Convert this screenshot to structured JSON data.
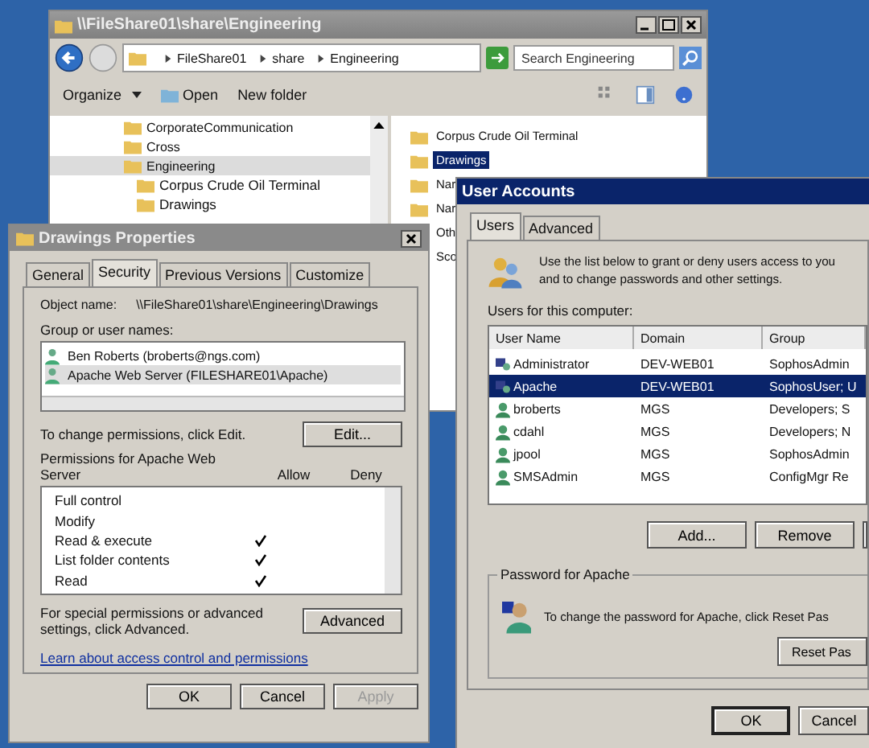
{
  "explorer": {
    "title": "\\\\FileShare01\\share\\Engineering",
    "breadcrumb": [
      "FileShare01",
      "share",
      "Engineering"
    ],
    "search": {
      "placeholder": "Search Engineering"
    },
    "toolbar": [
      "Organize",
      "Open",
      "New folder"
    ],
    "tree": [
      {
        "label": "CorporateCommunication",
        "selected": false
      },
      {
        "label": "Cross",
        "selected": false
      },
      {
        "label": "Engineering",
        "selected": true,
        "children": [
          {
            "label": "Corpus Crude Oil Terminal",
            "selected": false
          },
          {
            "label": "Drawings",
            "selected": false
          }
        ]
      }
    ],
    "items": [
      {
        "label": "Corpus Crude Oil Terminal",
        "selected": false
      },
      {
        "label": "Drawings",
        "selected": true
      },
      {
        "label": "Nar",
        "selected": false
      },
      {
        "label": "Nar",
        "selected": false
      },
      {
        "label": "Oth",
        "selected": false
      },
      {
        "label": "Sco",
        "selected": false
      }
    ]
  },
  "properties": {
    "title": "Drawings Properties",
    "tabs": [
      {
        "label": "General",
        "selected": false
      },
      {
        "label": "Security",
        "selected": true
      },
      {
        "label": "Previous Versions",
        "selected": false
      },
      {
        "label": "Customize",
        "selected": false
      }
    ],
    "object_label": "Object name:",
    "object_value": "\\\\FileShare01\\share\\Engineering\\Drawings",
    "group_label": "Group or user names:",
    "principals": [
      {
        "name": "Ben Roberts (broberts@ngs.com)",
        "selected": false
      },
      {
        "name": "Apache Web Server (FILESHARE01\\Apache)",
        "selected": true
      }
    ],
    "change_hint": "To change permissions, click Edit.",
    "edit_button": "Edit...",
    "permissions_label": "Permissions for Apache Web Server",
    "allow_header": "Allow",
    "deny_header": "Deny",
    "permissions": [
      {
        "name": "Full control",
        "allow": false,
        "deny": false
      },
      {
        "name": "Modify",
        "allow": false,
        "deny": false
      },
      {
        "name": "Read & execute",
        "allow": true,
        "deny": false
      },
      {
        "name": "List folder contents",
        "allow": true,
        "deny": false
      },
      {
        "name": "Read",
        "allow": true,
        "deny": false
      }
    ],
    "advanced_hint": "For special permissions or advanced settings, click Advanced.",
    "advanced_button": "Advanced",
    "link": "Learn about access control and permissions",
    "buttons": [
      {
        "label": "OK",
        "disabled": false
      },
      {
        "label": "Cancel",
        "disabled": false
      },
      {
        "label": "Apply",
        "disabled": true
      }
    ]
  },
  "user_accounts": {
    "title": "User Accounts",
    "tabs": [
      {
        "label": "Users",
        "selected": true
      },
      {
        "label": "Advanced",
        "selected": false
      }
    ],
    "intro": [
      "Use the list below to grant or deny users access to you",
      "and to change passwords and other settings."
    ],
    "list_label": "Users for this computer:",
    "columns": [
      "User Name",
      "Domain",
      "Group"
    ],
    "rows": [
      {
        "kind": "admin",
        "cells": [
          "Administrator",
          "DEV-WEB01",
          "SophosAdmin"
        ],
        "selected": false
      },
      {
        "kind": "admin",
        "cells": [
          "Apache",
          "DEV-WEB01",
          "SophosUser; U"
        ],
        "selected": true
      },
      {
        "kind": "domain",
        "cells": [
          "broberts",
          "MGS",
          "Developers; S"
        ],
        "selected": false
      },
      {
        "kind": "domain",
        "cells": [
          "cdahl",
          "MGS",
          "Developers; N"
        ],
        "selected": false
      },
      {
        "kind": "domain",
        "cells": [
          "jpool",
          "MGS",
          "SophosAdmin"
        ],
        "selected": false
      },
      {
        "kind": "domain",
        "cells": [
          "SMSAdmin",
          "MGS",
          "ConfigMgr Re"
        ],
        "selected": false
      }
    ],
    "list_buttons": [
      "Add...",
      "Remove"
    ],
    "password_group": "Password for Apache",
    "password_text": "To change the password for Apache, click Reset Pas",
    "reset_button": "Reset Pas",
    "buttons": [
      "OK",
      "Cancel"
    ]
  }
}
